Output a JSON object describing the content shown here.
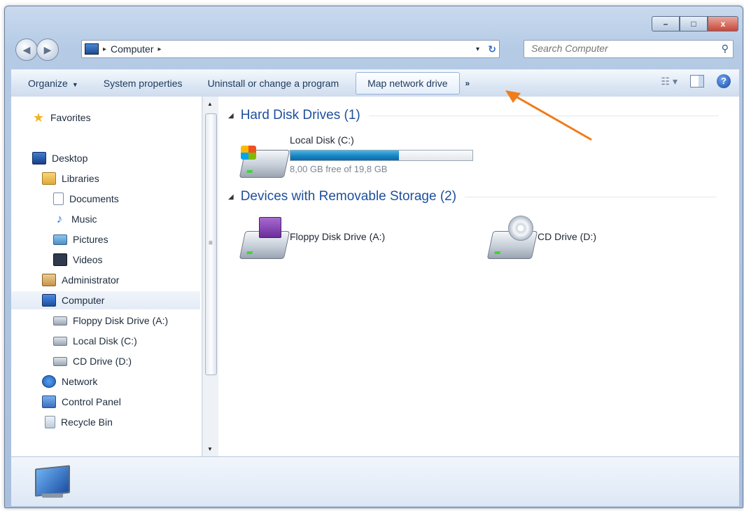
{
  "window": {
    "minimize_glyph": "–",
    "maximize_glyph": "□",
    "close_glyph": "x"
  },
  "address": {
    "back_glyph": "◀",
    "forward_glyph": "▶",
    "separator": "▸",
    "crumb": "Computer",
    "dropdown_glyph": "▾",
    "refresh_glyph": "↻"
  },
  "search": {
    "placeholder": "Search Computer",
    "icon_glyph": "⚲"
  },
  "toolbar": {
    "organize": "Organize",
    "organize_caret": "▼",
    "system_properties": "System properties",
    "uninstall": "Uninstall or change a program",
    "map_network_drive": "Map network drive",
    "more": "»",
    "views_glyph": "☷ ▾",
    "help_glyph": "?"
  },
  "nav": {
    "items": [
      {
        "label": "Favorites"
      },
      {
        "label": "Desktop"
      },
      {
        "label": "Libraries"
      },
      {
        "label": "Documents"
      },
      {
        "label": "Music"
      },
      {
        "label": "Pictures"
      },
      {
        "label": "Videos"
      },
      {
        "label": "Administrator"
      },
      {
        "label": "Computer"
      },
      {
        "label": "Floppy Disk Drive (A:)"
      },
      {
        "label": "Local Disk (C:)"
      },
      {
        "label": "CD Drive (D:)"
      },
      {
        "label": "Network"
      },
      {
        "label": "Control Panel"
      },
      {
        "label": "Recycle Bin"
      }
    ],
    "selected": "Computer",
    "scroll_up": "▲",
    "scroll_down": "▼",
    "scroll_grip": "≡"
  },
  "content": {
    "groups": [
      {
        "collapse_glyph": "◢",
        "title": "Hard Disk Drives (1)",
        "items": [
          {
            "name": "Local Disk (C:)",
            "free_text": "8,00 GB free of 19,8 GB",
            "used_fraction": 0.596
          }
        ]
      },
      {
        "collapse_glyph": "◢",
        "title": "Devices with Removable Storage (2)",
        "items": [
          {
            "name": "Floppy Disk Drive (A:)"
          },
          {
            "name": "CD Drive (D:)"
          }
        ]
      }
    ]
  },
  "colors": {
    "accent_arrow": "#f07d1a",
    "group_title": "#1e4f9d",
    "bar_fill": "#1a84c2"
  }
}
